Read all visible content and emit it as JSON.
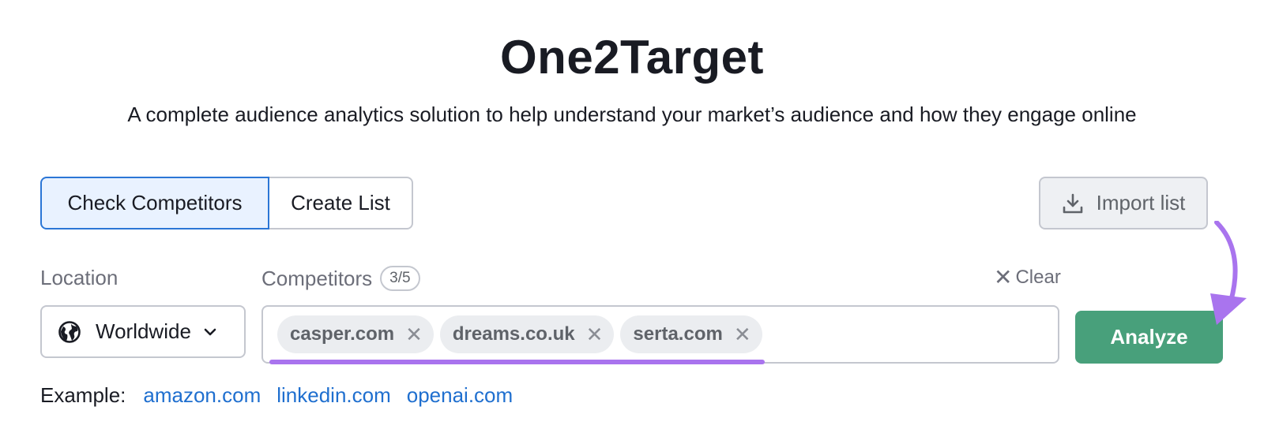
{
  "header": {
    "title": "One2Target",
    "subtitle": "A complete audience analytics solution to help understand your market’s audience and how they engage online"
  },
  "tabs": [
    {
      "label": "Check Competitors",
      "active": true
    },
    {
      "label": "Create List",
      "active": false
    }
  ],
  "import": {
    "label": "Import list",
    "icon": "download-icon"
  },
  "location": {
    "label": "Location",
    "value": "Worldwide",
    "icon": "globe-icon"
  },
  "competitors": {
    "label": "Competitors",
    "count": "3/5",
    "clear_label": "Clear",
    "chips": [
      "casper.com",
      "dreams.co.uk",
      "serta.com"
    ]
  },
  "analyze": {
    "label": "Analyze"
  },
  "examples": {
    "label": "Example:",
    "links": [
      "amazon.com",
      "linkedin.com",
      "openai.com"
    ]
  },
  "colors": {
    "accent": "#48a07b",
    "tab_active_border": "#2b76d6",
    "tab_active_bg": "#e9f2ff",
    "annotation": "#a974ee",
    "link": "#1f6fcf"
  }
}
